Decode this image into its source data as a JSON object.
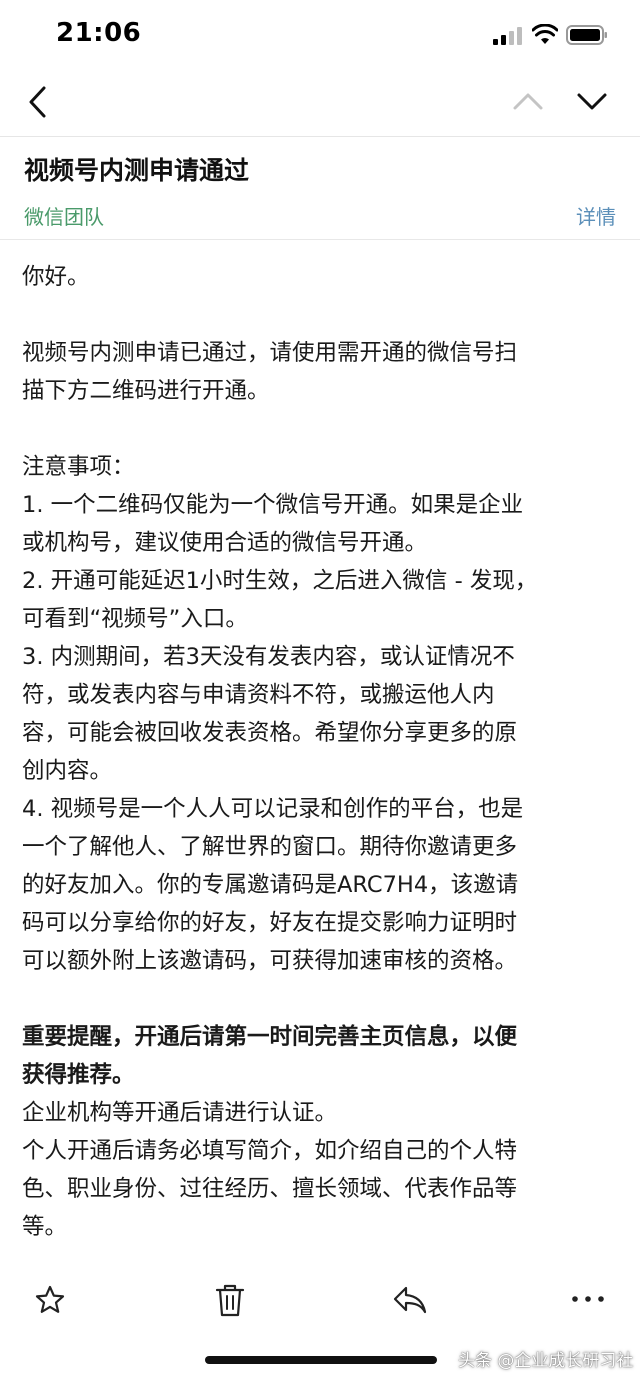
{
  "status_bar": {
    "time": "21:06"
  },
  "nav": {
    "back_icon": "chevron-left-icon",
    "prev_icon": "chevron-up-icon",
    "next_icon": "chevron-down-icon"
  },
  "mail": {
    "subject": "视频号内测申请通过",
    "sender": "微信团队",
    "details_label": "详情",
    "colors": {
      "sender": "#4a9a6a",
      "details": "#5b8fb9"
    }
  },
  "body": {
    "greeting": "你好。",
    "para1": [
      "视频号内测申请已通过，请使用需开通的微信号扫",
      "描下方二维码进行开通。"
    ],
    "notes_title": "注意事项：",
    "note1": [
      "1. 一个二维码仅能为一个微信号开通。如果是企业",
      "或机构号，建议使用合适的微信号开通。"
    ],
    "note2": [
      "2. 开通可能延迟1小时生效，之后进入微信 - 发现，",
      "可看到“视频号”入口。"
    ],
    "note3": [
      "3. 内测期间，若3天没有发表内容，或认证情况不",
      "符，或发表内容与申请资料不符，或搬运他人内",
      "容，可能会被回收发表资格。希望你分享更多的原",
      "创内容。"
    ],
    "note4": [
      "4. 视频号是一个人人可以记录和创作的平台，也是",
      "一个了解他人、了解世界的窗口。期待你邀请更多",
      "的好友加入。你的专属邀请码是ARC7H4，该邀请",
      "码可以分享给你的好友，好友在提交影响力证明时",
      "可以额外附上该邀请码，可获得加速审核的资格。"
    ],
    "reminder": [
      "重要提醒，开通后请第一时间完善主页信息，以便",
      "获得推荐。"
    ],
    "line_enterprise": "企业机构等开通后请进行认证。",
    "line_personal": [
      "个人开通后请务必填写简介，如介绍自己的个人特",
      "色、职业身份、过往经历、擅长领域、代表作品等",
      "等。"
    ]
  },
  "toolbar": {
    "star_icon": "star-icon",
    "trash_icon": "trash-icon",
    "reply_icon": "reply-icon",
    "more_icon": "more-icon"
  },
  "watermark": "头条 @企业成长研习社"
}
